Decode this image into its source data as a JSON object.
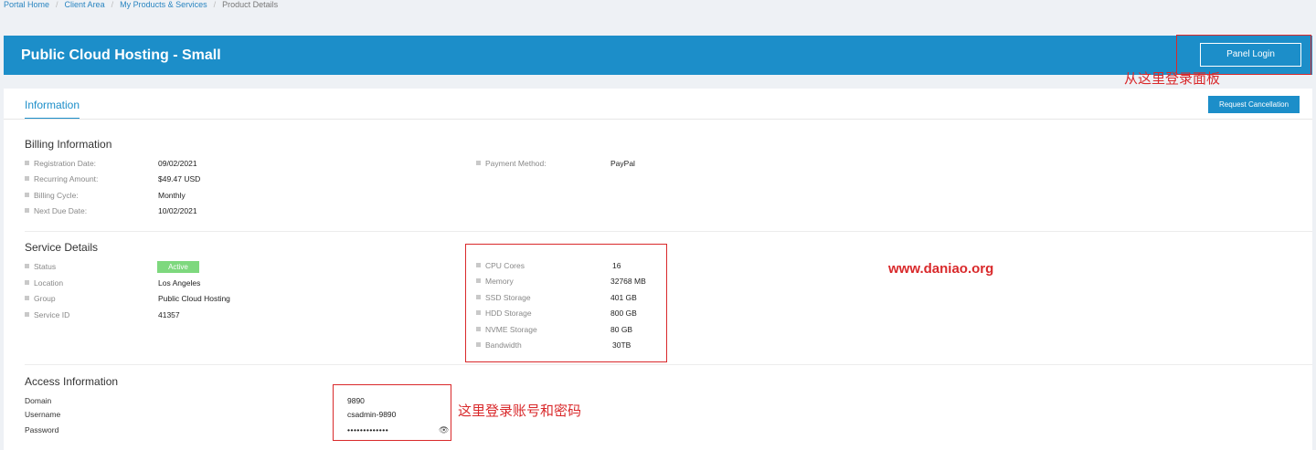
{
  "breadcrumb": [
    "Portal Home",
    "Client Area",
    "My Products & Services",
    "Product Details"
  ],
  "header": {
    "title": "Public Cloud Hosting - Small",
    "panel_login_label": "Panel Login"
  },
  "annotations": {
    "panel_login_note": "从这里登录面板",
    "watermark": "www.daniao.org",
    "credentials_note": "这里登录账号和密码"
  },
  "tabs": {
    "information": "Information"
  },
  "request_cancellation_label": "Request Cancellation",
  "billing": {
    "title": "Billing Information",
    "left": [
      {
        "label": "Registration Date:",
        "value": "09/02/2021"
      },
      {
        "label": "Recurring Amount:",
        "value": "$49.47 USD"
      },
      {
        "label": "Billing Cycle:",
        "value": "Monthly"
      },
      {
        "label": "Next Due Date:",
        "value": "10/02/2021"
      }
    ],
    "right": [
      {
        "label": "Payment Method:",
        "value": "PayPal"
      }
    ]
  },
  "service": {
    "title": "Service Details",
    "status_label": "Status",
    "status_value": "Active",
    "left": [
      {
        "label": "Location",
        "value": "Los Angeles"
      },
      {
        "label": "Group",
        "value": "Public Cloud Hosting"
      },
      {
        "label": "Service ID",
        "value": "41357"
      }
    ],
    "specs": [
      {
        "label": "CPU Cores",
        "value": "16"
      },
      {
        "label": "Memory",
        "value": "32768 MB"
      },
      {
        "label": "SSD Storage",
        "value": "401 GB"
      },
      {
        "label": "HDD Storage",
        "value": "800 GB"
      },
      {
        "label": "NVME Storage",
        "value": "80 GB"
      },
      {
        "label": "Bandwidth",
        "value": "30TB"
      }
    ]
  },
  "access": {
    "title": "Access Information",
    "rows": [
      {
        "label": "Domain",
        "value": "9890"
      },
      {
        "label": "Username",
        "value": "csadmin-9890"
      },
      {
        "label": "Password",
        "value": "•••••••••••••"
      }
    ]
  },
  "colors": {
    "primary": "#1c8ec9",
    "active_badge": "#7ed87e",
    "annotation": "#d9292b"
  }
}
